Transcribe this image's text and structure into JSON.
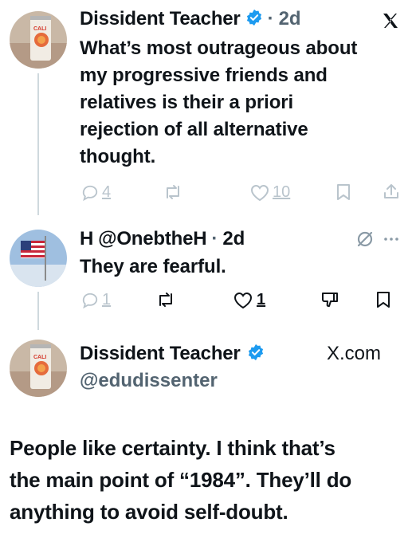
{
  "tweet1": {
    "author_name": "Dissident Teacher",
    "time": "2d",
    "text_lines": [
      "What’s most outrageous about",
      "my progressive friends and",
      "relatives is their a priori",
      "rejection of all alternative",
      "thought."
    ],
    "reply_count": "4",
    "like_count": "10"
  },
  "tweet2": {
    "author_name": "H",
    "handle": "@OnebtheH",
    "time": "2d",
    "text": "They are fearful.",
    "reply_count": "1",
    "like_count": "1"
  },
  "tweet3": {
    "author_name": "Dissident Teacher",
    "handle": "@edudissenter",
    "source": "X.com",
    "text_lines": [
      "People like certainty. I think that’s",
      "the main point of “1984”. They’ll do",
      "anything to avoid self-doubt."
    ]
  },
  "avatar_can_text": "CALI SQUEEZE",
  "colors": {
    "verified": "#1d9bf0",
    "muted_text": "#536471",
    "faded_icon": "#b9c4cc",
    "thread_line": "#cfd9de"
  },
  "icons": [
    "verified-badge-icon",
    "x-logo-icon",
    "reply-icon",
    "retweet-icon",
    "like-icon",
    "bookmark-icon",
    "share-icon",
    "more-icon",
    "grok-icon",
    "downvote-icon"
  ]
}
